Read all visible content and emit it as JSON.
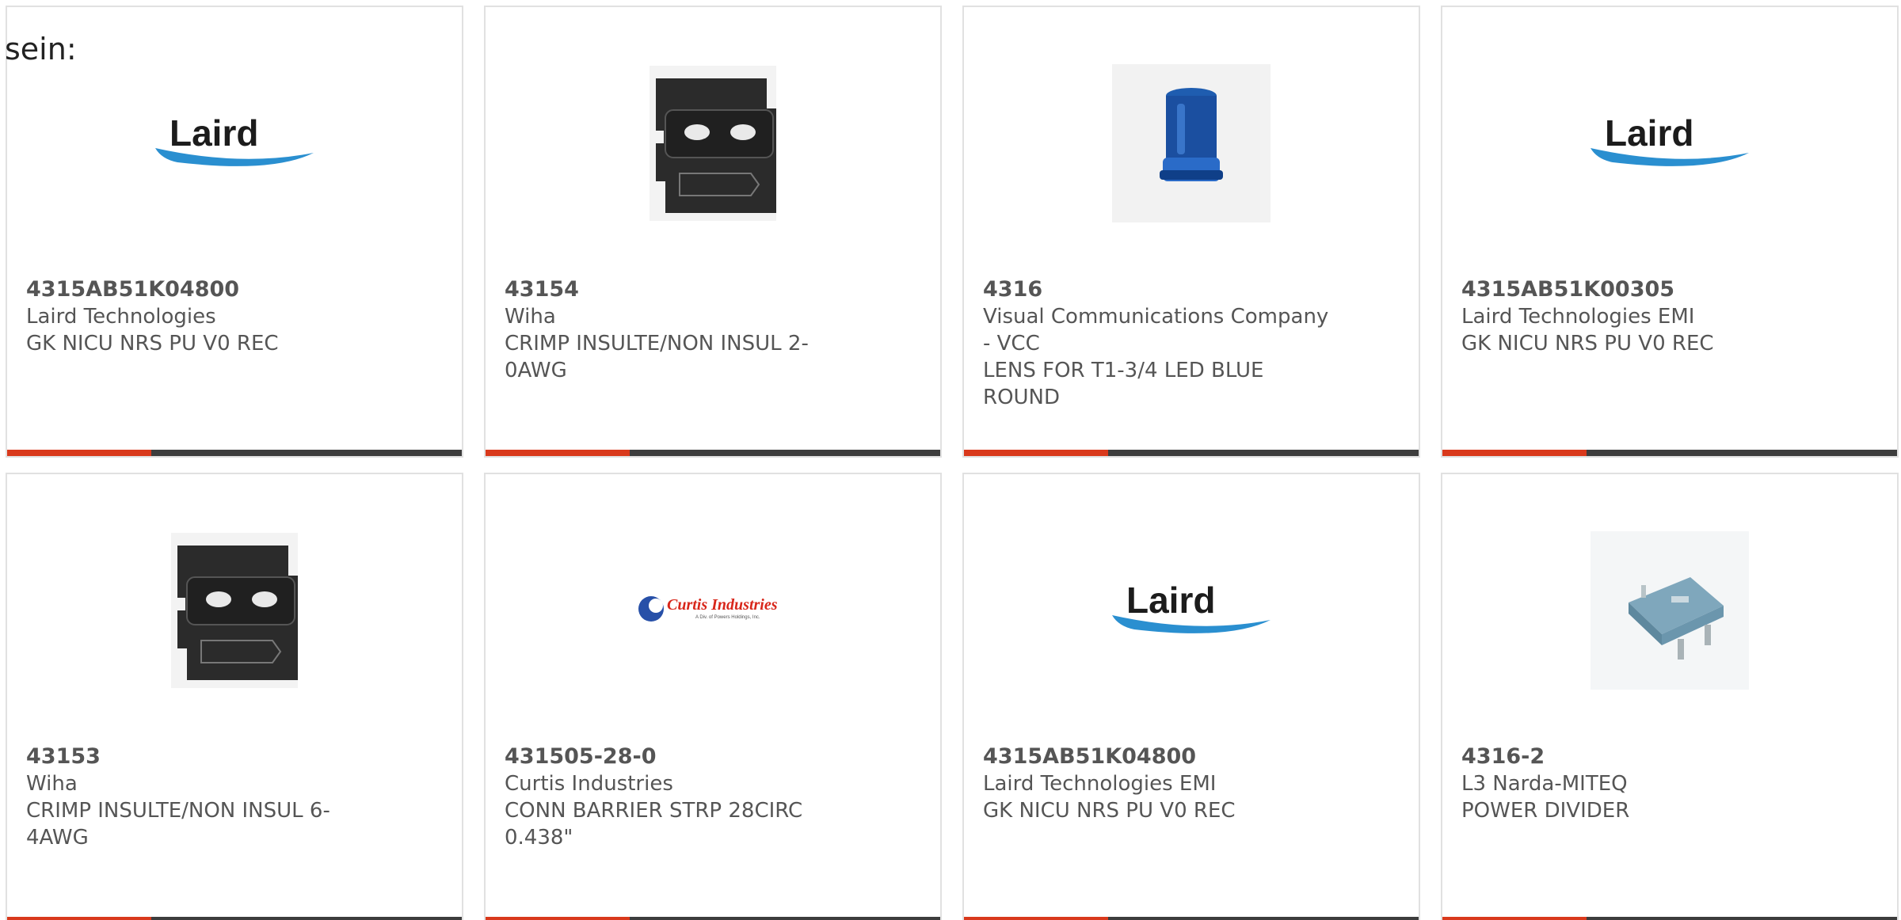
{
  "lead_text": "sein:",
  "colors": {
    "accent_bar": "#d9391c",
    "dark_bar": "#3d3d3d",
    "card_border": "#e1e1e1",
    "text": "#555555"
  },
  "products": [
    {
      "part_number": "4315AB51K04800",
      "manufacturer": "Laird Technologies",
      "description": "GK NICU NRS PU V0 REC",
      "image_icon": "laird-logo"
    },
    {
      "part_number": "43154",
      "manufacturer": "Wiha",
      "description": "CRIMP INSULTE/NON INSUL 2-0AWG",
      "image_icon": "crimp-die-icon"
    },
    {
      "part_number": "4316",
      "manufacturer": "Visual Communications Company - VCC",
      "description": "LENS FOR T1-3/4 LED BLUE ROUND",
      "image_icon": "blue-led-lens-icon"
    },
    {
      "part_number": "4315AB51K00305",
      "manufacturer": "Laird Technologies EMI",
      "description": "GK NICU NRS PU V0 REC",
      "image_icon": "laird-logo"
    },
    {
      "part_number": "43153",
      "manufacturer": "Wiha",
      "description": "CRIMP INSULTE/NON INSUL 6-4AWG",
      "image_icon": "crimp-die-icon"
    },
    {
      "part_number": "431505-28-0",
      "manufacturer": "Curtis Industries",
      "description": "CONN BARRIER STRP 28CIRC 0.438\"",
      "image_icon": "curtis-industries-logo"
    },
    {
      "part_number": "4315AB51K04800",
      "manufacturer": "Laird Technologies EMI",
      "description": "GK NICU NRS PU V0 REC",
      "image_icon": "laird-logo"
    },
    {
      "part_number": "4316-2",
      "manufacturer": "L3 Narda-MITEQ",
      "description": "POWER DIVIDER",
      "image_icon": "power-divider-icon"
    }
  ],
  "logo_text": {
    "laird": "Laird",
    "curtis": "Curtis Industries",
    "curtis_sub": "A Div. of Powers Holdings, Inc."
  }
}
